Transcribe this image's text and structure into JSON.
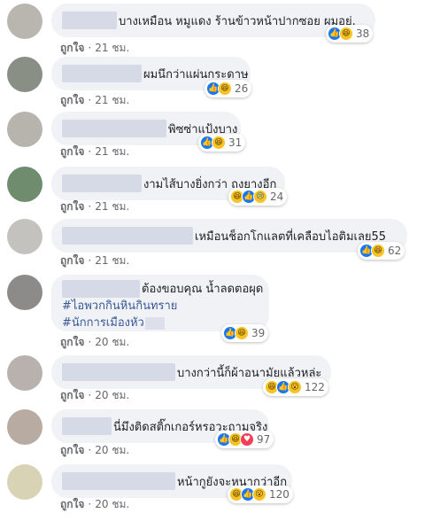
{
  "like_label": "ถูกใจ",
  "separator": "·",
  "comments": [
    {
      "text": "บางเหมือน หมูแดง ร้านข้าวหน้าปากซอย ผมอยู่.",
      "time": "21 ชม.",
      "count": "38",
      "reactions": [
        "like-icon",
        "haha-icon"
      ],
      "avatar_color": "#b9b6b0"
    },
    {
      "text": "ผมนึกว่าแผ่นกระดาษ",
      "time": "21 ชม.",
      "count": "26",
      "reactions": [
        "like-icon",
        "haha-icon"
      ],
      "avatar_color": "#8a8f86"
    },
    {
      "text": "พิซซ่าแป้งบาง",
      "time": "21 ชม.",
      "count": "31",
      "reactions": [
        "like-icon",
        "haha-icon"
      ],
      "avatar_color": "#b7b3ad"
    },
    {
      "text": "งามไส้บางยิ่งกว่า ถุงยางอีก",
      "time": "21 ชม.",
      "count": "24",
      "reactions": [
        "haha-icon",
        "like-icon",
        "sad-icon"
      ],
      "avatar_color": "#6f8c6e"
    },
    {
      "text": "เหมือนช็อกโกแลตที่เคลือบไอติมเลย55",
      "time": "21 ชม.",
      "count": "62",
      "reactions": [
        "like-icon",
        "haha-icon"
      ],
      "avatar_color": "#c4c2bf"
    },
    {
      "text": "ต้องขอบคุณ น้ำลดตอผุด",
      "hashtags": [
        "#ไอพวกกินหินกินทราย",
        "#นักการเมืองหัว"
      ],
      "time": "20 ชม.",
      "count": "39",
      "reactions": [
        "like-icon",
        "haha-icon"
      ],
      "avatar_color": "#8d8b89"
    },
    {
      "text": "บางกว่านี้ก็ผ้าอนามัยแล้วหล่ะ",
      "time": "20 ชม.",
      "count": "122",
      "reactions": [
        "haha-icon",
        "like-icon",
        "wow-icon"
      ],
      "avatar_color": "#b9b1ad"
    },
    {
      "text": "นี่มึงติดสติ๊กเกอร์หรอวะถามจริง",
      "time": "20 ชม.",
      "count": "97",
      "reactions": [
        "like-icon",
        "haha-icon",
        "love-icon"
      ],
      "avatar_color": "#b8aca2"
    },
    {
      "text": "หน้ากูยังจะหนากว่าอีก",
      "time": "20 ชม.",
      "count": "120",
      "reactions": [
        "haha-icon",
        "like-icon",
        "wow-icon"
      ],
      "avatar_color": "#d9d3b5"
    }
  ]
}
